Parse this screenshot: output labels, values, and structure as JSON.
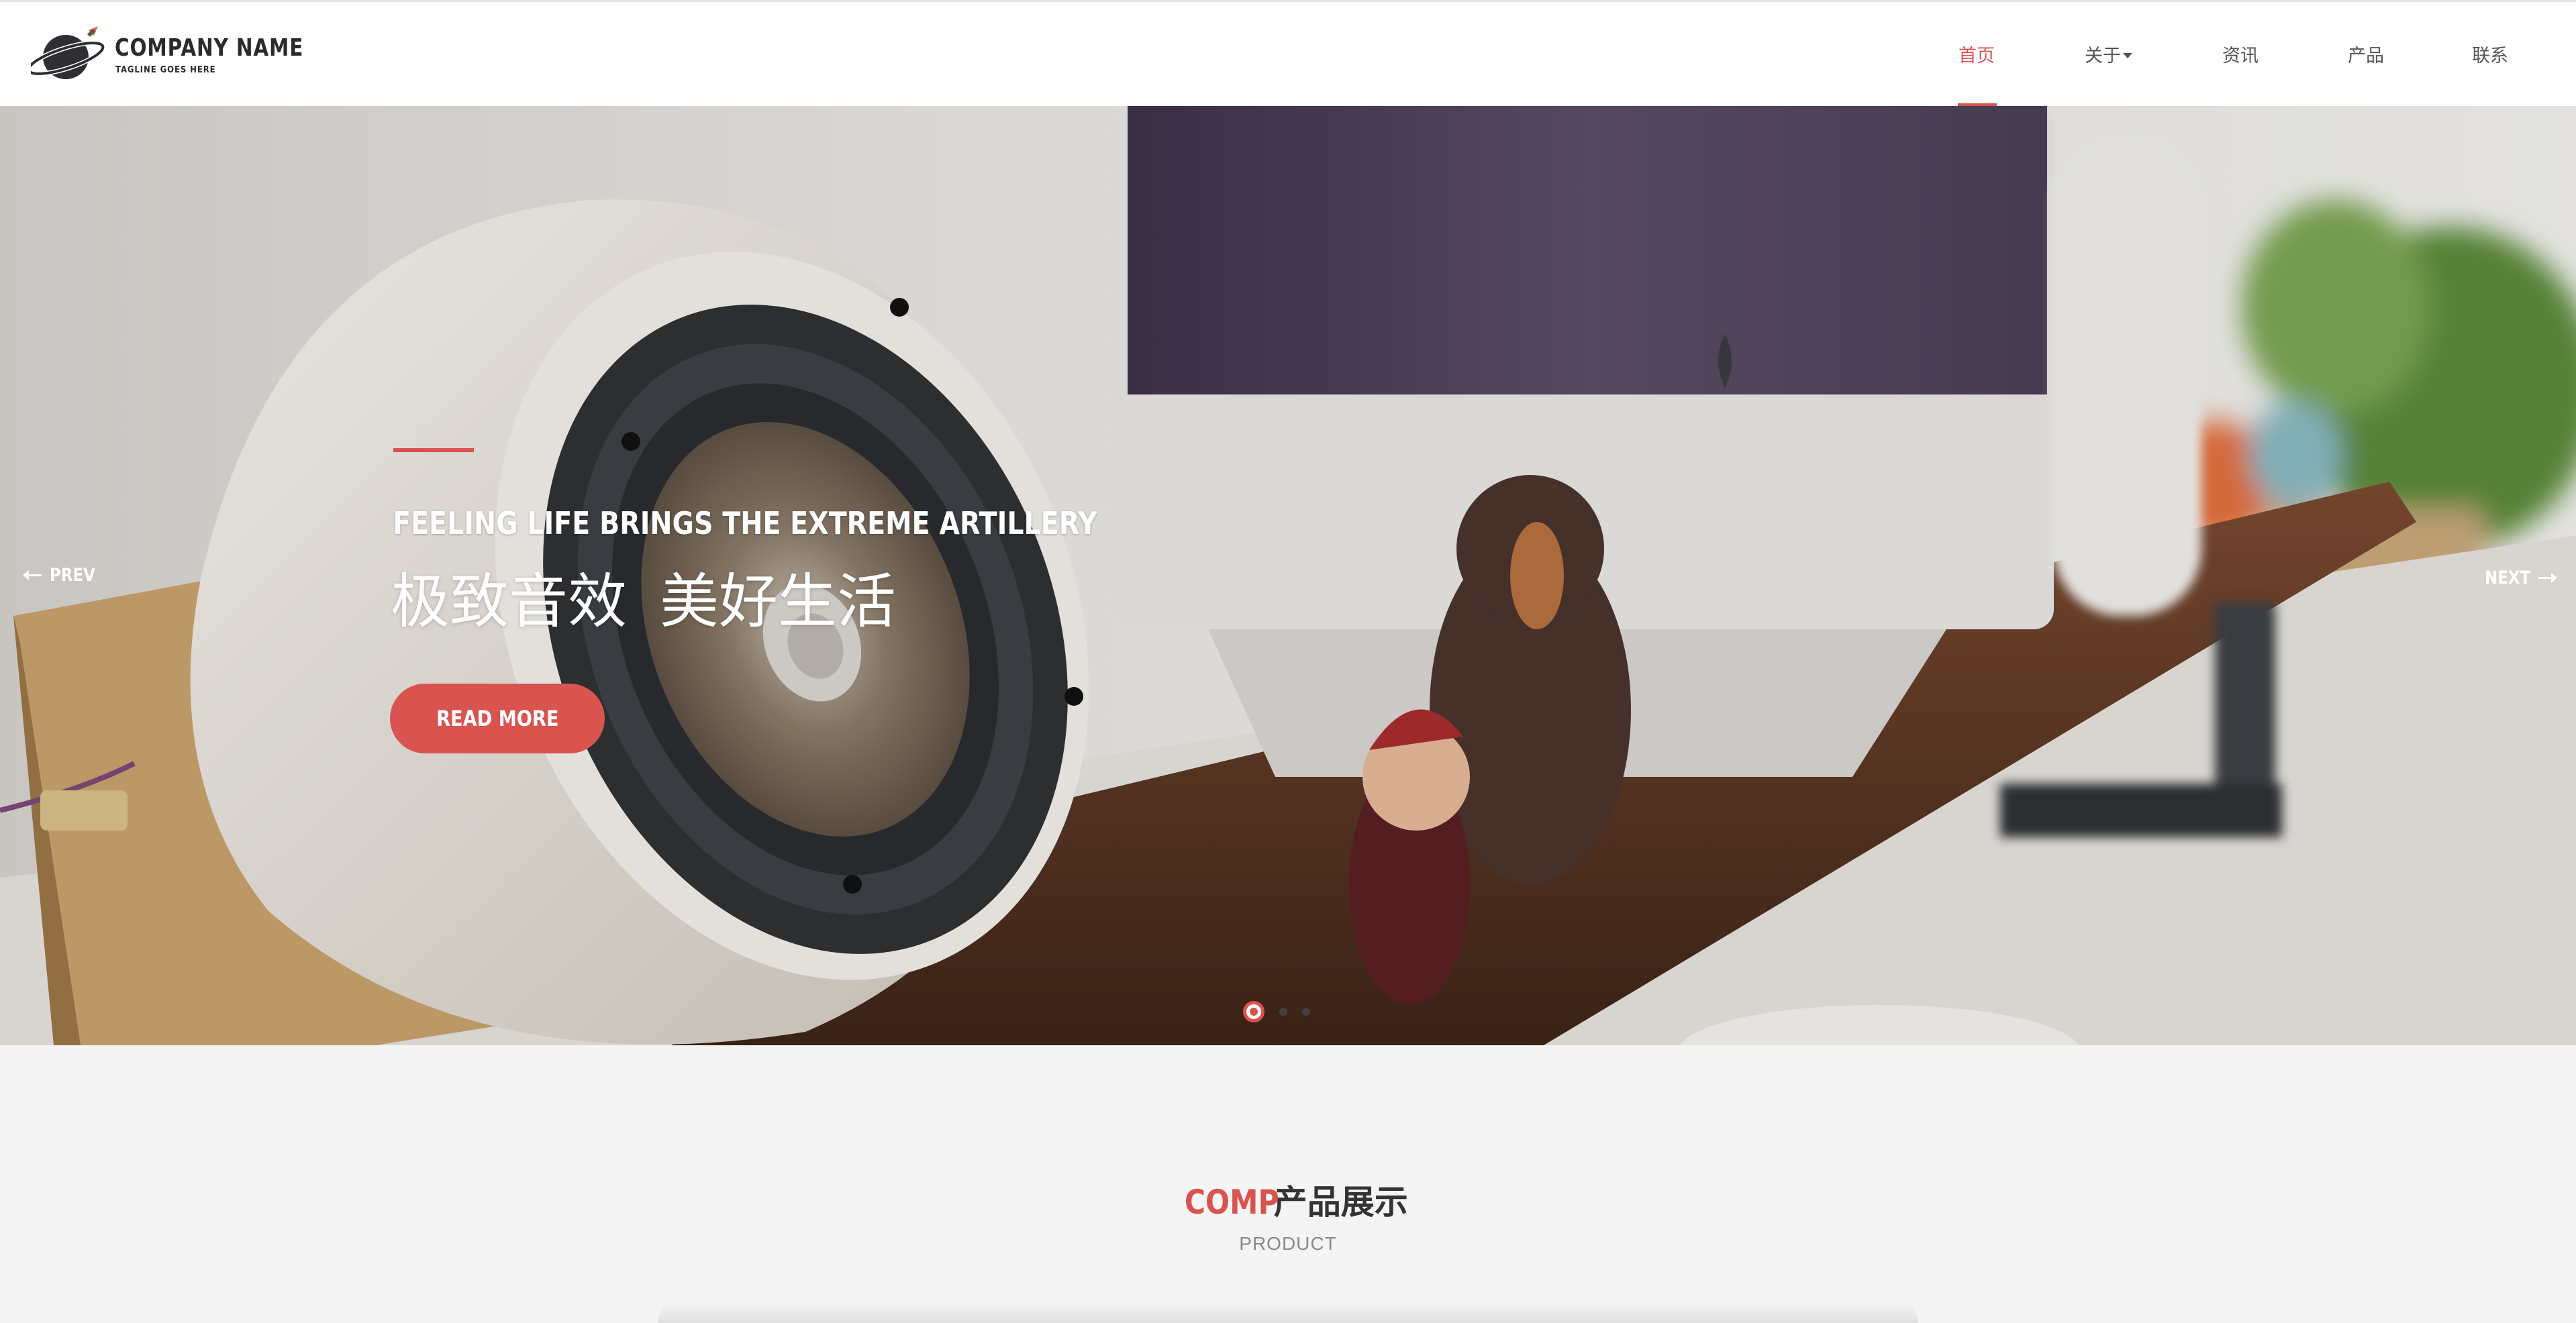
{
  "brand": {
    "name": "COMPANY NAME",
    "tagline": "TAGLINE GOES HERE",
    "accent_color": "#d9534f"
  },
  "nav": {
    "items": [
      {
        "label": "首页",
        "active": true
      },
      {
        "label": "关于",
        "has_dropdown": true
      },
      {
        "label": "资讯"
      },
      {
        "label": "产品"
      },
      {
        "label": "联系"
      }
    ]
  },
  "hero": {
    "subtitle_en": "FEELING LIFE BRINGS THE EXTREME ARTILLERY",
    "title_cn": "极致音效  美好生活",
    "cta_label": "READ MORE",
    "prev_label": "PREV",
    "next_label": "NEXT",
    "slide_count": 3,
    "active_slide": 1
  },
  "section": {
    "title_accent": "COMP",
    "title": "产品展示",
    "subtitle": "PRODUCT"
  }
}
